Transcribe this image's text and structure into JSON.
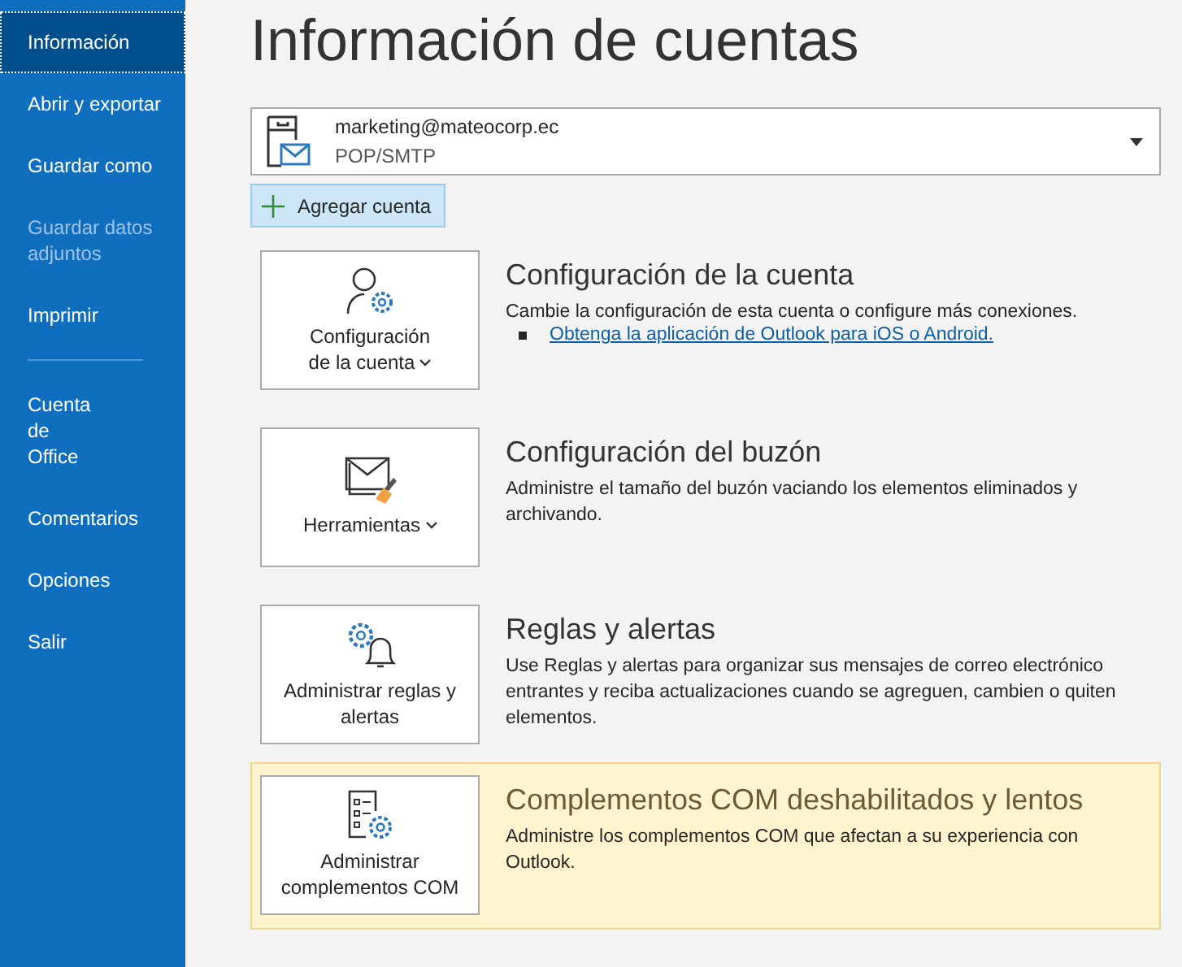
{
  "sidebar": {
    "groups": [
      [
        {
          "label": "Información",
          "selected": true,
          "disabled": false
        },
        {
          "label": "Abrir y exportar",
          "selected": false,
          "disabled": false
        },
        {
          "label": "Guardar como",
          "selected": false,
          "disabled": false
        },
        {
          "label": "Guardar datos\nadjuntos",
          "selected": false,
          "disabled": true
        },
        {
          "label": "Imprimir",
          "selected": false,
          "disabled": false
        }
      ],
      [
        {
          "label": "Cuenta\nde\nOffice",
          "selected": false,
          "disabled": false
        },
        {
          "label": "Comentarios",
          "selected": false,
          "disabled": false
        },
        {
          "label": "Opciones",
          "selected": false,
          "disabled": false
        },
        {
          "label": "Salir",
          "selected": false,
          "disabled": false
        }
      ]
    ]
  },
  "title": "Información de cuentas",
  "account": {
    "email": "marketing@mateocorp.ec",
    "type": "POP/SMTP"
  },
  "add_account": "Agregar cuenta",
  "sections": [
    {
      "kind": "account",
      "button": "Configuración\nde la cuenta",
      "dropdown": true,
      "highlighted": false,
      "heading": "Configuración de la cuenta",
      "description": "Cambie la configuración de esta cuenta o configure más conexiones.",
      "link": "Obtenga la aplicación de Outlook para iOS o Android."
    },
    {
      "kind": "tools",
      "button": "Herramientas",
      "dropdown": true,
      "highlighted": false,
      "heading": "Configuración del buzón",
      "description": "Administre el tamaño del buzón vaciando los elementos eliminados y archivando."
    },
    {
      "kind": "rules",
      "button": "Administrar reglas y alertas",
      "dropdown": false,
      "highlighted": false,
      "heading": "Reglas y alertas",
      "description": "Use Reglas y alertas para organizar sus mensajes de correo electrónico entrantes y reciba actualizaciones cuando se agreguen, cambien o quiten elementos."
    },
    {
      "kind": "com",
      "button": "Administrar complementos COM",
      "dropdown": false,
      "highlighted": true,
      "heading": "Complementos COM deshabilitados y lentos",
      "description": "Administre los complementos COM que afectan a su experiencia con Outlook."
    }
  ]
}
